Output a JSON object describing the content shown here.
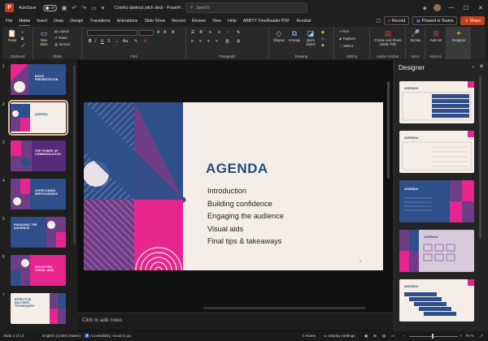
{
  "titlebar": {
    "autosave_label": "AutoSave",
    "autosave_state": "Off",
    "doc_title": "Colorful abstract pitch deck  -  PowerP...",
    "search_placeholder": "Search"
  },
  "menu": {
    "tabs": [
      "File",
      "Home",
      "Insert",
      "Draw",
      "Design",
      "Transitions",
      "Animations",
      "Slide Show",
      "Record",
      "Review",
      "View",
      "Help",
      "ABBYY FineReader PDF",
      "Acrobat"
    ],
    "active": "Home",
    "record_label": "Record",
    "present_label": "Present in Teams",
    "share_label": "Share"
  },
  "ribbon": {
    "paste": "Paste",
    "new_slide": "New\nSlide",
    "layout": "Layout",
    "reset": "Reset",
    "section": "Section",
    "shapes": "Shapes",
    "arrange": "Arrange",
    "quick_styles": "Quick\nStyles",
    "find": "Find",
    "replace": "Replace",
    "select": "Select",
    "create_share": "Create and Share\nAdobe PDF",
    "dictate": "Dictate",
    "addins": "Add-ins",
    "designer": "Designer",
    "groups": [
      "Clipboard",
      "Slides",
      "Font",
      "Paragraph",
      "Drawing",
      "Editing",
      "Adobe Acrobat",
      "Voice",
      "Add-ins"
    ]
  },
  "thumbnails": [
    {
      "num": "1",
      "title": "BASIC PRESENTATION"
    },
    {
      "num": "2",
      "title": "AGENDA"
    },
    {
      "num": "3",
      "title": "THE POWER OF COMMUNICATION"
    },
    {
      "num": "4",
      "title": "OVERCOMING NERVOUSNESS"
    },
    {
      "num": "5",
      "title": "ENGAGING THE AUDIENCE"
    },
    {
      "num": "6",
      "title": "SELECTING VISUAL AIDS"
    },
    {
      "num": "7",
      "title": "EFFECTIVE DELIVERY TECHNIQUES"
    }
  ],
  "slide": {
    "title": "AGENDA",
    "items": [
      "Introduction",
      "Building confidence",
      "Engaging the audience",
      "Visual aids",
      "Final tips & takeaways"
    ],
    "page_number": "2"
  },
  "notes_placeholder": "Click to add notes",
  "designer": {
    "title": "Designer",
    "thumb_heading": "AGENDA"
  },
  "status": {
    "slide": "Slide 2 of 13",
    "language": "English (United States)",
    "accessibility": "Accessibility: Good to go",
    "notes": "Notes",
    "display_settings": "Display Settings",
    "zoom": "75 %"
  },
  "colors": {
    "navy": "#1f4e79",
    "magenta": "#e7258e",
    "purple": "#6e3d86",
    "cream": "#f5eee6",
    "accent": "#c43e1c"
  }
}
